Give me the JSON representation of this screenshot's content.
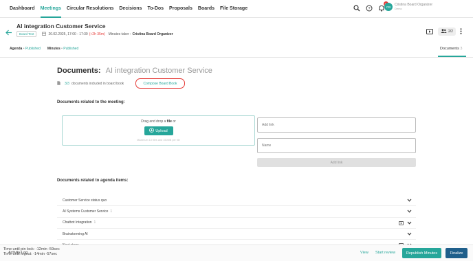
{
  "nav": {
    "items": [
      "Dashboard",
      "Meetings",
      "Circular Resolutions",
      "Decisions",
      "To-Dos",
      "Proposals",
      "Boards",
      "File Storage"
    ],
    "active": "Meetings",
    "notification_count": "14",
    "user_initials": "CB",
    "user_name": "Cristina Board Organizer",
    "user_role": "Demo"
  },
  "meeting": {
    "title": "AI integration Customer Service",
    "board_tag": "Board Test",
    "datetime": "20.02.2025, 17:00 - 17:30",
    "late": "(+2h 35m)",
    "minutes_taker_label": "Minutes taker :",
    "minutes_taker": "Cristina Board Organizer",
    "participants": "2/2"
  },
  "subtabs": {
    "agenda_label": "Agenda",
    "agenda_status": "Published",
    "minutes_label": "Minutes",
    "minutes_status": "Published",
    "documents_label": "Documents",
    "documents_count": "3"
  },
  "documents": {
    "heading": "Documents:",
    "meeting_name": "AI integration Customer Service",
    "included_count": "3/3",
    "included_text": "documents included in board book",
    "compose_label": "Compose Board Book",
    "meeting_section": "Documents related to the meeting:",
    "drop_text_prefix": "Drag and drop a",
    "drop_text_file": "file",
    "drop_text_suffix": "or",
    "upload_label": "Upload",
    "upload_hint": "Maximum 10 files and 150MB per file",
    "add_link_placeholder": "Add link",
    "name_placeholder": "Name",
    "add_link_button": "Add link",
    "agenda_section": "Documents related to agenda items:",
    "agenda_items": [
      {
        "label": "Customer Service status quo",
        "count": ""
      },
      {
        "label": "AI Systems Customer Service",
        "count": "1"
      },
      {
        "label": "Chatbot Integration",
        "count": "1"
      },
      {
        "label": "Brainstorming AI",
        "count": ""
      },
      {
        "label": "Next steps",
        "count": ""
      }
    ]
  },
  "footer": {
    "pin_lock": "Time until pin lock: -12min -59sec",
    "logout": "Time until logout:  -14min -57sec",
    "activity_log": "Activity Log",
    "view": "View",
    "start_review": "Start review",
    "republish": "Republish Minutes",
    "finalize": "Finalize"
  },
  "colors": {
    "accent": "#26a69a",
    "danger": "#e53935",
    "navy": "#1f5f8b"
  }
}
